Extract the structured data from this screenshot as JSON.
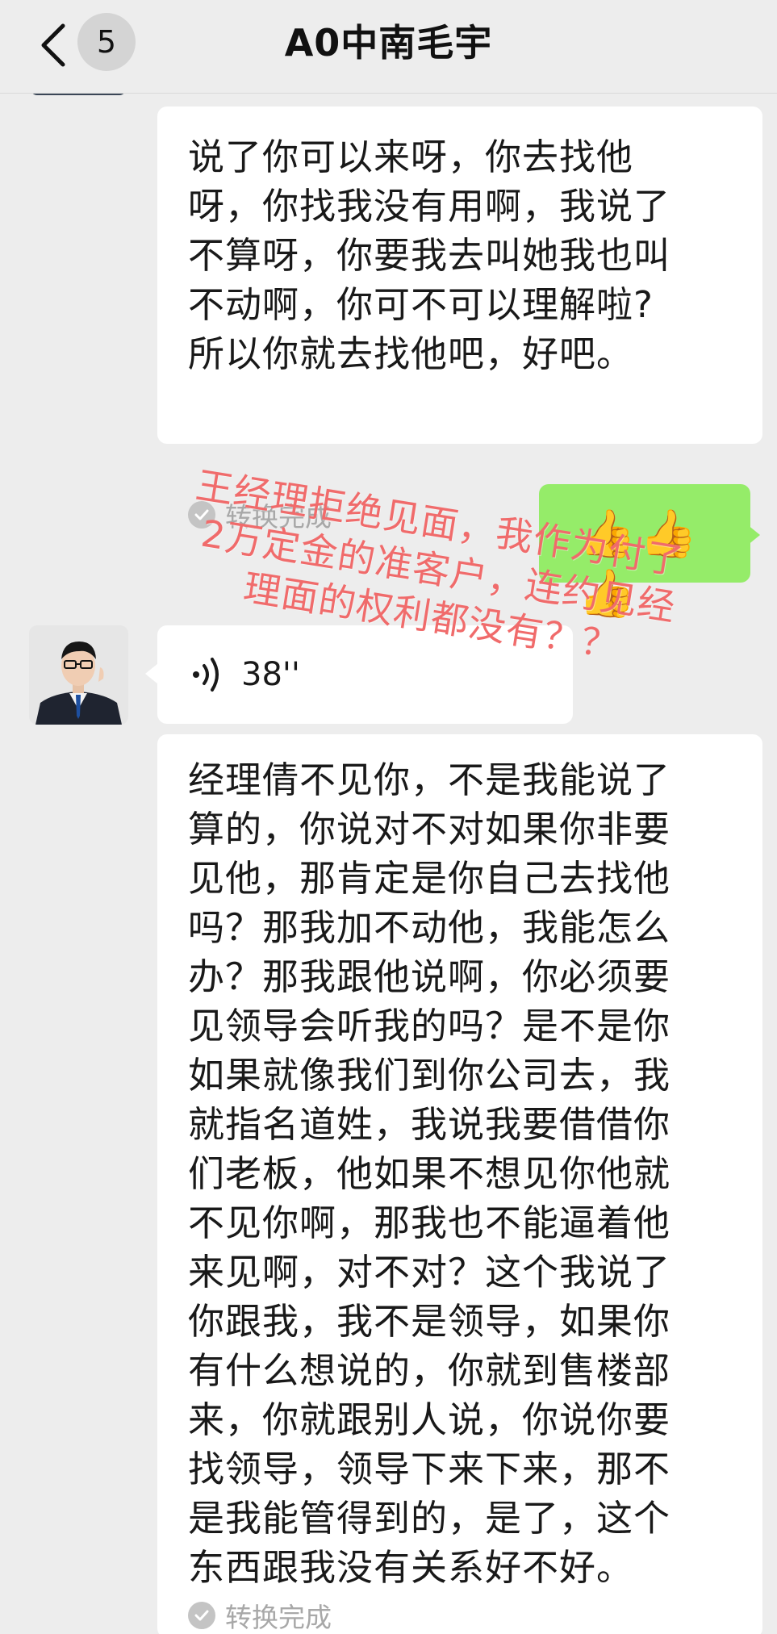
{
  "header": {
    "title": "A0中南毛宇",
    "unread_count": "5"
  },
  "messages": [
    {
      "side": "left",
      "type": "voice_transcript",
      "text": "说了你可以来呀，你去找他\n呀，你找我没有用啊，我说了\n不算呀，你要我去叫她我也叫\n不动啊，你可不可以理解啦?\n所以你就去找他吧，好吧。",
      "status": "转换完成"
    },
    {
      "side": "right",
      "type": "emoji",
      "text": "👍👍👍"
    },
    {
      "side": "left",
      "type": "voice",
      "duration": "38''"
    },
    {
      "side": "left",
      "type": "voice_transcript",
      "text": "经理倩不见你，不是我能说了\n算的，你说对不对如果你非要\n见他，那肯定是你自己去找他\n吗？那我加不动他，我能怎么\n办？那我跟他说啊，你必须要\n见领导会听我的吗？是不是你\n如果就像我们到你公司去，我\n就指名道姓，我说我要借借你\n们老板，他如果不想见你他就\n不见你啊，那我也不能逼着他\n来见啊，对不对？这个我说了\n你跟我，我不是领导，如果你\n有什么想说的，你就到售楼部\n来，你就跟别人说，你说你要\n找领导，领导下来下来，那不\n是我能管得到的，是了，这个\n东西跟我没有关系好不好。",
      "status": "转换完成"
    }
  ],
  "annotation": {
    "text": "王经理拒绝见面，我作为付了\n 2万定金的准客户，连约见经\n     理面的权利都没有？？",
    "color": "#f06b6b"
  },
  "icons": {
    "back": "chevron-left-icon",
    "voice": "voice-wave-icon",
    "check": "check-circle-icon"
  }
}
